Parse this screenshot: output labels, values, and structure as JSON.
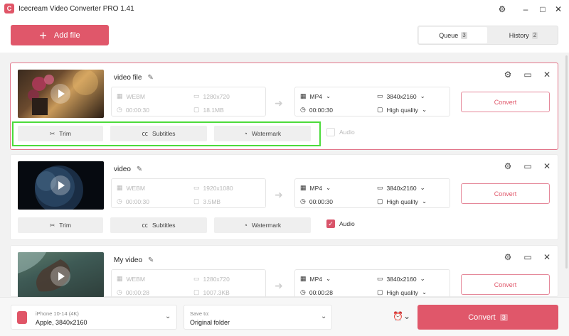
{
  "app": {
    "title": "Icecream Video Converter PRO 1.41",
    "logo_letter": "C"
  },
  "window": {
    "settings_icon": "gear-icon",
    "minimize": "–",
    "maximize": "□",
    "close": "✕"
  },
  "toolbar": {
    "add_file_label": "Add file",
    "tabs": [
      {
        "label": "Queue",
        "count": "3"
      },
      {
        "label": "History",
        "count": "2"
      }
    ]
  },
  "items": [
    {
      "name": "video file",
      "src": {
        "format": "WEBM",
        "resolution": "1280x720",
        "duration": "00:00:30",
        "size": "18.1MB"
      },
      "dst": {
        "format": "MP4",
        "resolution": "3840x2160",
        "duration": "00:00:30",
        "quality": "High quality"
      },
      "convert_label": "Convert",
      "trim_label": "Trim",
      "subtitles_label": "Subtitles",
      "watermark_label": "Watermark",
      "audio_label": "Audio",
      "audio_checked": false
    },
    {
      "name": "video",
      "src": {
        "format": "WEBM",
        "resolution": "1920x1080",
        "duration": "00:00:30",
        "size": "3.5MB"
      },
      "dst": {
        "format": "MP4",
        "resolution": "3840x2160",
        "duration": "00:00:30",
        "quality": "High quality"
      },
      "convert_label": "Convert",
      "trim_label": "Trim",
      "subtitles_label": "Subtitles",
      "watermark_label": "Watermark",
      "audio_label": "Audio",
      "audio_checked": true
    },
    {
      "name": "My video",
      "src": {
        "format": "WEBM",
        "resolution": "1280x720",
        "duration": "00:00:28",
        "size": "1007.3KB"
      },
      "dst": {
        "format": "MP4",
        "resolution": "3840x2160",
        "duration": "00:00:28",
        "quality": "High quality"
      },
      "convert_label": "Convert"
    }
  ],
  "bottom": {
    "profile_device": "iPhone 10-14 (4K)",
    "profile_detail": "Apple, 3840x2160",
    "save_to_label": "Save to:",
    "save_to_value": "Original folder",
    "convert_all_label": "Convert",
    "convert_all_count": "3"
  },
  "colors": {
    "accent": "#e0576a",
    "highlight_box": "#4cdb3b"
  }
}
